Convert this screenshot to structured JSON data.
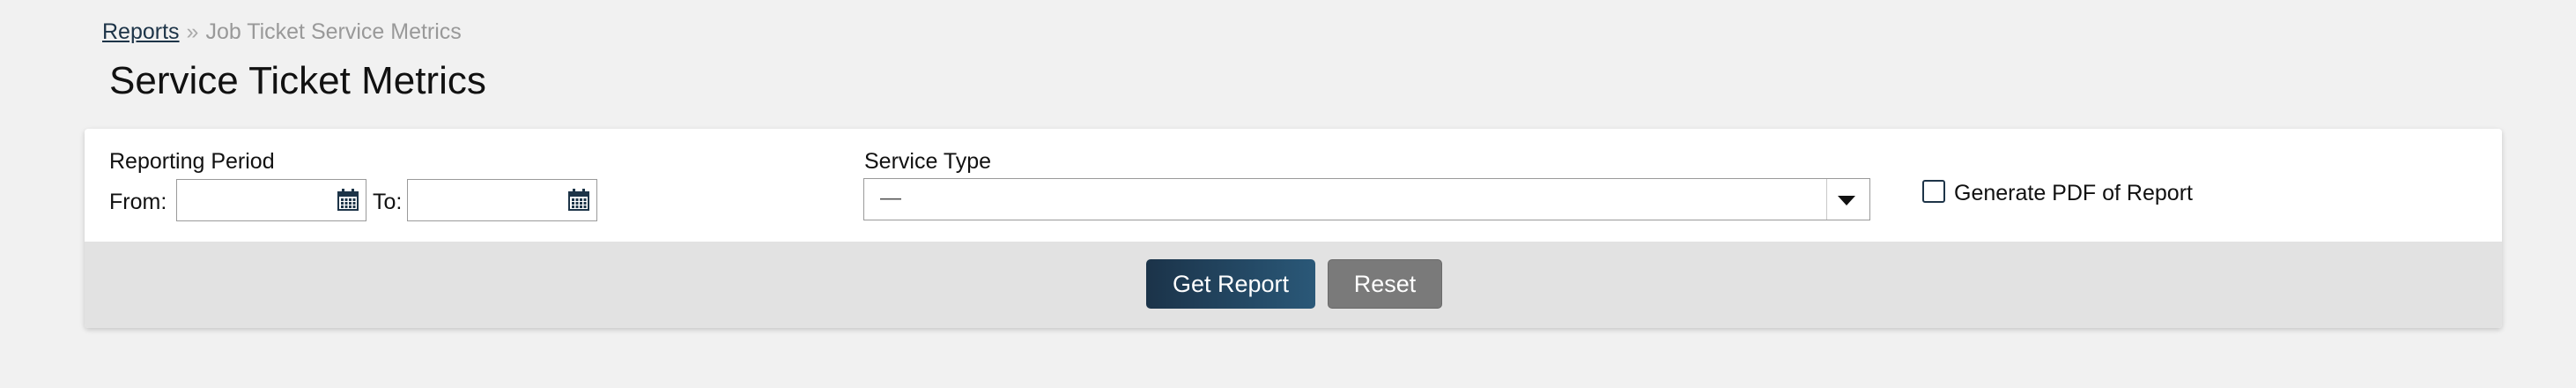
{
  "breadcrumb": {
    "parent_label": "Reports",
    "separator": "»",
    "current_label": "Job Ticket Service Metrics"
  },
  "page": {
    "title": "Service Ticket Metrics"
  },
  "filters": {
    "reporting_period": {
      "label": "Reporting Period",
      "from_label": "From:",
      "from_value": "",
      "to_label": "To:",
      "to_value": ""
    },
    "service_type": {
      "label": "Service Type",
      "selected_value": "—"
    },
    "generate_pdf": {
      "label": "Generate PDF of Report",
      "checked": false
    }
  },
  "actions": {
    "get_report_label": "Get Report",
    "reset_label": "Reset"
  },
  "icons": {
    "calendar": "calendar-icon",
    "dropdown": "chevron-down-icon"
  },
  "colors": {
    "primary": "#1b3349",
    "secondary_button": "#7a7a7a",
    "footer_bg": "#e2e2e2",
    "page_bg": "#f1f1f1"
  }
}
